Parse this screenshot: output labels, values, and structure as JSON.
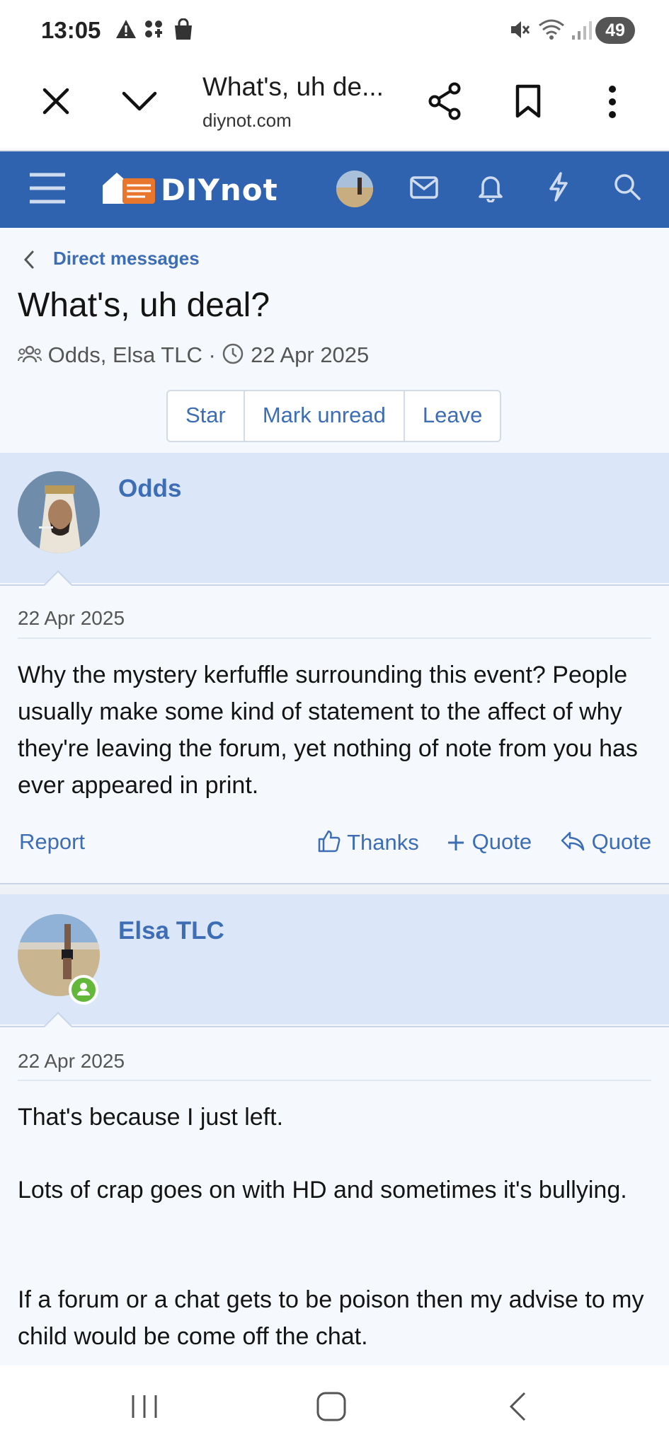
{
  "status_bar": {
    "time": "13:05",
    "battery": "49",
    "icons": [
      "warning-icon",
      "apps-icon",
      "bag-icon",
      "mute-icon",
      "wifi-icon",
      "signal-icon"
    ]
  },
  "browser": {
    "title": "What's, uh de...",
    "url": "diynot.com"
  },
  "site_nav": {
    "logo": "DIYnot",
    "icons": [
      "menu-icon",
      "avatar",
      "mail-icon",
      "bell-icon",
      "lightning-icon",
      "search-icon"
    ],
    "color": "#2f63b0"
  },
  "conversation": {
    "breadcrumb": "Direct messages",
    "title": "What's, uh deal?",
    "participants": "Odds, Elsa TLC",
    "separator": "·",
    "date": "22 Apr 2025",
    "buttons": {
      "star": "Star",
      "mark_unread": "Mark unread",
      "leave": "Leave"
    }
  },
  "messages": [
    {
      "user": "Odds",
      "date": "22 Apr 2025",
      "text": "Why the mystery kerfuffle surrounding this event? People usually make some kind of statement to the affect of why they're leaving the forum, yet nothing of note from you has ever appeared in print.",
      "actions": {
        "report": "Report",
        "thanks": "Thanks",
        "quote_plus": "Quote",
        "quote_reply": "Quote"
      }
    },
    {
      "user": "Elsa TLC",
      "date": "22 Apr 2025",
      "paragraphs": [
        "That's because I just left.",
        "Lots of crap goes on with HD and sometimes it's bullying.",
        "If a forum or a chat gets to be poison then my advise to my child would be come off the chat."
      ]
    }
  ],
  "colors": {
    "accent": "#3d6db5",
    "header_bg": "#dbe7f8",
    "page_bg": "#f5f8fc"
  }
}
